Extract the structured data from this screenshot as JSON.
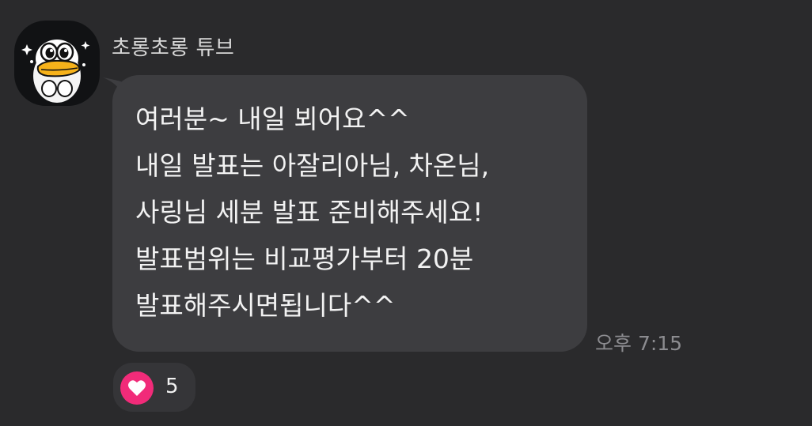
{
  "sender": {
    "name": "초롱초롱 튜브",
    "avatar_icon": "duck-character-avatar"
  },
  "message": {
    "lines": [
      "여러분~ 내일 뵈어요^^",
      "내일 발표는 아잘리아님, 차온님,",
      "사링님 세분 발표 준비해주세요!",
      "발표범위는 비교평가부터 20분",
      "발표해주시면됩니다^^"
    ],
    "timestamp": "오후 7:15"
  },
  "reaction": {
    "icon": "heart-icon",
    "count": "5"
  },
  "colors": {
    "background": "#2a2a2c",
    "bubble": "#3d3d40",
    "reaction_accent": "#f12b79",
    "timestamp": "#8c8c90"
  }
}
